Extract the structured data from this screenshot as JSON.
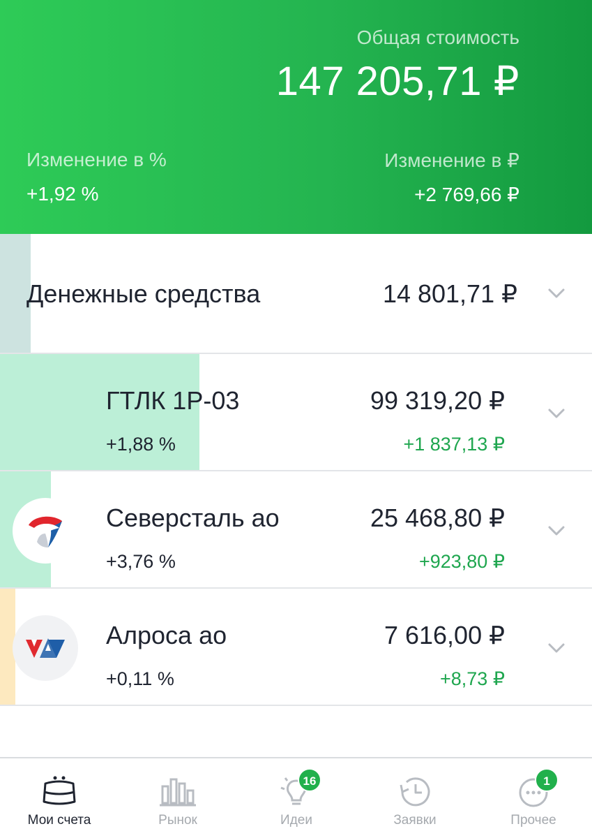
{
  "header": {
    "total_label": "Общая стоимость",
    "total_value": "147 205,71 ₽",
    "change_pct_label": "Изменение в  %",
    "change_pct_value": "+1,92  %",
    "change_rub_label": "Изменение в ₽",
    "change_rub_value": "+2 769,66 ₽",
    "gradient_colors": [
      "#2ecb57",
      "#139a3f"
    ]
  },
  "cash": {
    "name": "Денежные средства",
    "value": "14 801,71 ₽"
  },
  "assets": [
    {
      "name": "ГТЛК 1Р-03",
      "value": "99 319,20 ₽",
      "pct": "+1,88  %",
      "profit": "+1 837,13 ₽",
      "logo": "none"
    },
    {
      "name": "Северсталь ао",
      "value": "25 468,80 ₽",
      "pct": "+3,76  %",
      "profit": "+923,80 ₽",
      "logo": "severstal-logo"
    },
    {
      "name": "Алроса ао",
      "value": "7 616,00 ₽",
      "pct": "+0,11  %",
      "profit": "+8,73 ₽",
      "logo": "alrosa-logo"
    }
  ],
  "nav": {
    "items": [
      {
        "label": "Мои счета",
        "icon": "wallet-icon",
        "active": true
      },
      {
        "label": "Рынок",
        "icon": "bar-chart-icon",
        "active": false
      },
      {
        "label": "Идеи",
        "icon": "lightbulb-icon",
        "badge": "16",
        "active": false
      },
      {
        "label": "Заявки",
        "icon": "history-clock-icon",
        "active": false
      },
      {
        "label": "Прочее",
        "icon": "more-dots-icon",
        "badge": "1",
        "active": false
      }
    ]
  },
  "colors": {
    "profit_green": "#1fa64f",
    "badge_green": "#21b04c",
    "cash_bar": "#cde3e0",
    "stock_bar": "#bcefd7",
    "alrosa_bar": "#fde9bf"
  }
}
